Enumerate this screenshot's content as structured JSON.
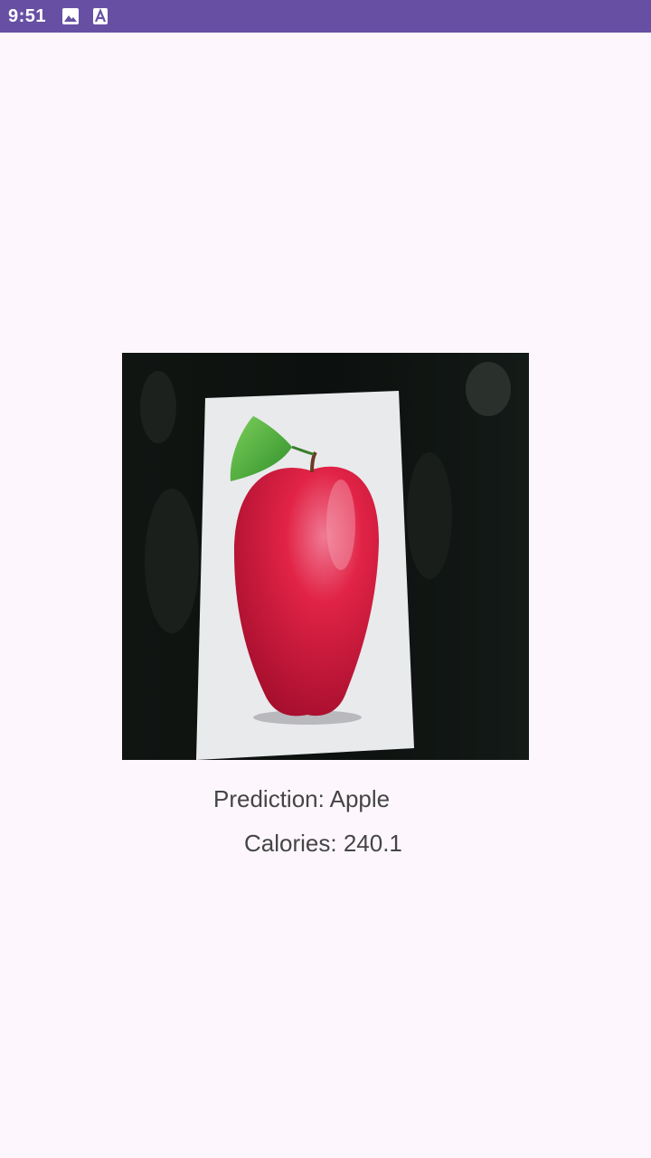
{
  "status_bar": {
    "time": "9:51",
    "icons": [
      "gallery-icon",
      "text-notification-icon"
    ],
    "color": "#6750a4"
  },
  "result": {
    "prediction": "Prediction: Apple",
    "calories": "Calories: 240.1"
  },
  "colors": {
    "background": "#fdf7fd",
    "text": "#454545"
  }
}
